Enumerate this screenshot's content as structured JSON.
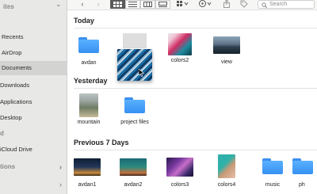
{
  "sidebar": {
    "favorites_header": "ites",
    "items": [
      {
        "label": "Recents"
      },
      {
        "label": "AirDrop"
      },
      {
        "label": "Documents",
        "selected": true
      },
      {
        "label": "Downloads"
      },
      {
        "label": "Applications"
      },
      {
        "label": "Desktop"
      }
    ],
    "icloud_header": "d",
    "icloud_item": "iCloud Drive",
    "locations_header": "tions"
  },
  "toolbar": {
    "search_placeholder": "Search"
  },
  "sections": {
    "today": {
      "title": "Today",
      "items": [
        {
          "name": "avdan",
          "kind": "folder"
        },
        {
          "name": "colors2",
          "kind": "image"
        },
        {
          "name": "view",
          "kind": "image"
        }
      ]
    },
    "yesterday": {
      "title": "Yesterday",
      "items": [
        {
          "name": "mountain",
          "kind": "image"
        },
        {
          "name": "project files",
          "kind": "folder"
        }
      ]
    },
    "prev7": {
      "title": "Previous 7 Days",
      "items": [
        {
          "name": "avdan1",
          "kind": "image"
        },
        {
          "name": "avdan2",
          "kind": "image"
        },
        {
          "name": "colors3",
          "kind": "image"
        },
        {
          "name": "colors4",
          "kind": "image"
        },
        {
          "name": "music",
          "kind": "folder"
        },
        {
          "name": "ph",
          "kind": "folder"
        }
      ]
    }
  },
  "icons": [
    "back-icon",
    "forward-icon",
    "grid-view-icon",
    "list-view-icon",
    "column-view-icon",
    "gallery-view-icon",
    "group-icon",
    "action-icon",
    "share-icon",
    "tag-icon",
    "search-icon",
    "folder-icon"
  ],
  "colors": {
    "folder_blue": "#3690f2",
    "sidebar_bg": "#e8e8e6",
    "selection": "#d3d3d1"
  }
}
